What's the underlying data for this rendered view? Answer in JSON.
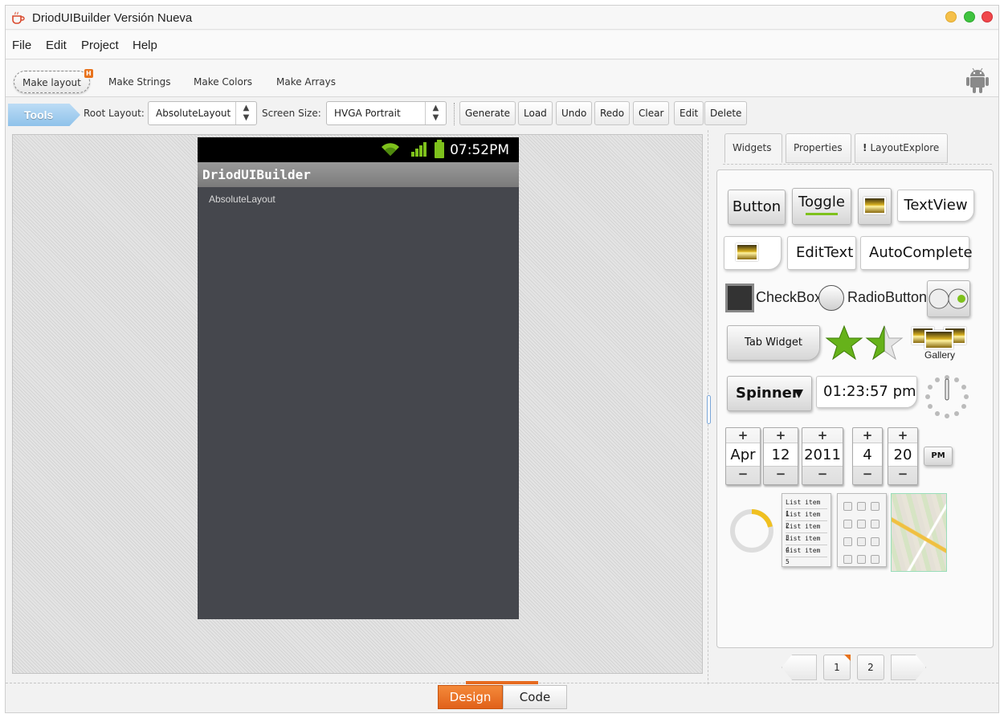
{
  "window": {
    "title": "DriodUIBuilder Versión Nueva"
  },
  "menu": [
    "File",
    "Edit",
    "Project",
    "Help"
  ],
  "subtabs": [
    "Make layout",
    "Make Strings",
    "Make Colors",
    "Make Arrays"
  ],
  "subtab_badge": "H",
  "toolbar": {
    "tools_label": "Tools",
    "root_layout_label": "Root Layout:",
    "root_layout_value": "AbsoluteLayout",
    "screen_size_label": "Screen Size:",
    "screen_size_value": "HVGA Portrait",
    "buttons": [
      "Generate",
      "Load",
      "Undo",
      "Redo",
      "Clear",
      "Edit",
      "Delete"
    ]
  },
  "device": {
    "clock": "07:52PM",
    "app_title": "DriodUIBuilder",
    "layout_label": "AbsoluteLayout",
    "accent_color": "#7ec11c"
  },
  "panel": {
    "tabs": [
      "Widgets",
      "Properties",
      "LayoutExplore"
    ],
    "layout_tab_mark": "!",
    "widgets": {
      "button": "Button",
      "toggle": "Toggle",
      "textview": "TextView",
      "edittext": "EditText",
      "autocomplete": "AutoComplete",
      "checkbox": "CheckBox",
      "radiobutton": "RadioButton",
      "tab_widget": "Tab Widget",
      "gallery": "Gallery",
      "spinner": "Spinner",
      "time": "01:23:57 pm",
      "date_month": "Apr",
      "date_day": "12",
      "date_year": "2011",
      "time_hour": "4",
      "time_minute": "20",
      "ampm": "PM",
      "plus": "+",
      "minus": "−",
      "list_items": [
        "List item 1",
        "List item 2",
        "List item 3",
        "List item 4",
        "List item 5"
      ]
    }
  },
  "pager": {
    "pages": [
      "1",
      "2"
    ],
    "current": "1"
  },
  "modes": {
    "design": "Design",
    "code": "Code",
    "active": "Design"
  },
  "colors": {
    "accent": "#e66a1f",
    "tools_tag": "#8fc2ea"
  }
}
